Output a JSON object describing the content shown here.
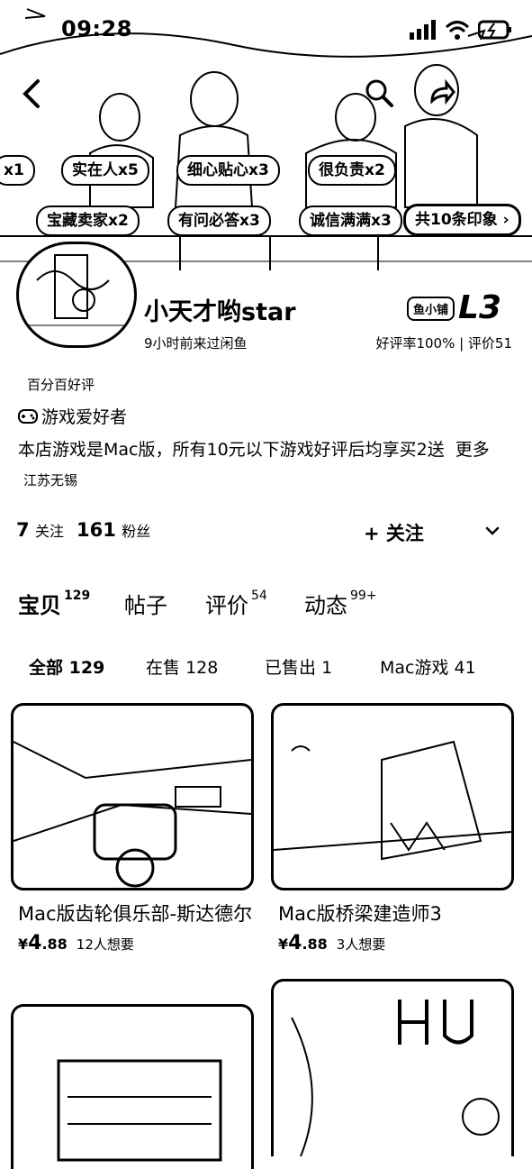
{
  "status_bar": {
    "time": "09:28"
  },
  "header": {
    "tags_row1": [
      {
        "label": "x1",
        "count": ""
      },
      {
        "label": "实在人",
        "count": "x5"
      },
      {
        "label": "细心贴心",
        "count": "x3"
      },
      {
        "label": "很负责",
        "count": "x2"
      }
    ],
    "tags_row2": [
      {
        "label": "宝藏卖家",
        "count": "x2"
      },
      {
        "label": "有问必答",
        "count": "x3"
      },
      {
        "label": "诚信满满",
        "count": "x3"
      }
    ],
    "tags_more": "共10条印象"
  },
  "profile": {
    "nickname": "小天才哟star",
    "level_badge": "鱼小铺",
    "level": "L3",
    "last_seen": "9小时前来过闲鱼",
    "rating": "好评率100% | 评价51",
    "badge_text": "百分百好评",
    "interest": "游戏爱好者",
    "bio": "本店游戏是Mac版，所有10元以下游戏好评后均享买2送",
    "bio_more": "更多",
    "location": "江苏无锡"
  },
  "stats": {
    "following_count": "7",
    "following_label": "关注",
    "fans_count": "161",
    "fans_label": "粉丝",
    "follow_button": "+ 关注"
  },
  "tabs": [
    {
      "label": "宝贝",
      "count": "129"
    },
    {
      "label": "帖子",
      "count": ""
    },
    {
      "label": "评价",
      "count": "54"
    },
    {
      "label": "动态",
      "count": "99+"
    }
  ],
  "subtabs": [
    {
      "label": "全部",
      "count": "129"
    },
    {
      "label": "在售",
      "count": "128"
    },
    {
      "label": "已售出",
      "count": "1"
    },
    {
      "label": "Mac游戏",
      "count": "41"
    }
  ],
  "items": [
    {
      "title": "Mac版齿轮俱乐部-斯达德尔",
      "currency": "¥",
      "price_int": "4",
      "price_dec": ".88",
      "wants": "12人想要"
    },
    {
      "title": "Mac版桥梁建造师3",
      "currency": "¥",
      "price_int": "4",
      "price_dec": ".88",
      "wants": "3人想要"
    }
  ],
  "colors": {
    "text": "#000000",
    "background": "#ffffff"
  },
  "icons": [
    "back-icon",
    "search-icon",
    "share-icon",
    "signal-icon",
    "wifi-icon",
    "battery-icon",
    "gamepad-icon",
    "chevron-down-icon"
  ]
}
